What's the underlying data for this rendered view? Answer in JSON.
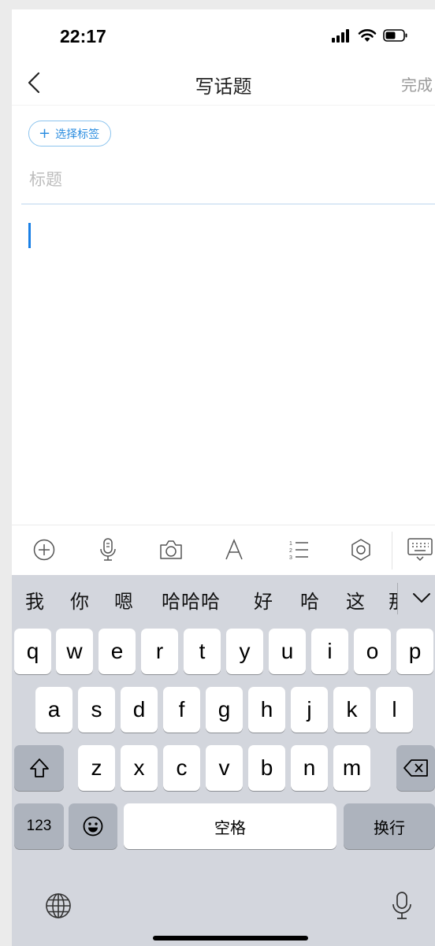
{
  "status_bar": {
    "time": "22:17"
  },
  "nav": {
    "title": "写话题",
    "done_label": "完成"
  },
  "editor": {
    "tag_button_label": "选择标签",
    "title_placeholder": "标题",
    "title_value": ""
  },
  "toolbar": {
    "tools": [
      "add-icon",
      "microphone-icon",
      "camera-icon",
      "font-icon",
      "numbered-list-icon",
      "settings-icon",
      "keyboard-hide-icon"
    ]
  },
  "keyboard": {
    "candidates": [
      "我",
      "你",
      "嗯",
      "哈哈哈",
      "好",
      "哈",
      "这",
      "那"
    ],
    "row1": [
      "q",
      "w",
      "e",
      "r",
      "t",
      "y",
      "u",
      "i",
      "o",
      "p"
    ],
    "row2": [
      "a",
      "s",
      "d",
      "f",
      "g",
      "h",
      "j",
      "k",
      "l"
    ],
    "row3": [
      "z",
      "x",
      "c",
      "v",
      "b",
      "n",
      "m"
    ],
    "numbers_label": "123",
    "space_label": "空格",
    "return_label": "换行"
  },
  "colors": {
    "accent": "#2b8de0",
    "caret": "#1a80e6",
    "keyboard_bg": "#d3d6dd",
    "special_key": "#adb3bd"
  }
}
